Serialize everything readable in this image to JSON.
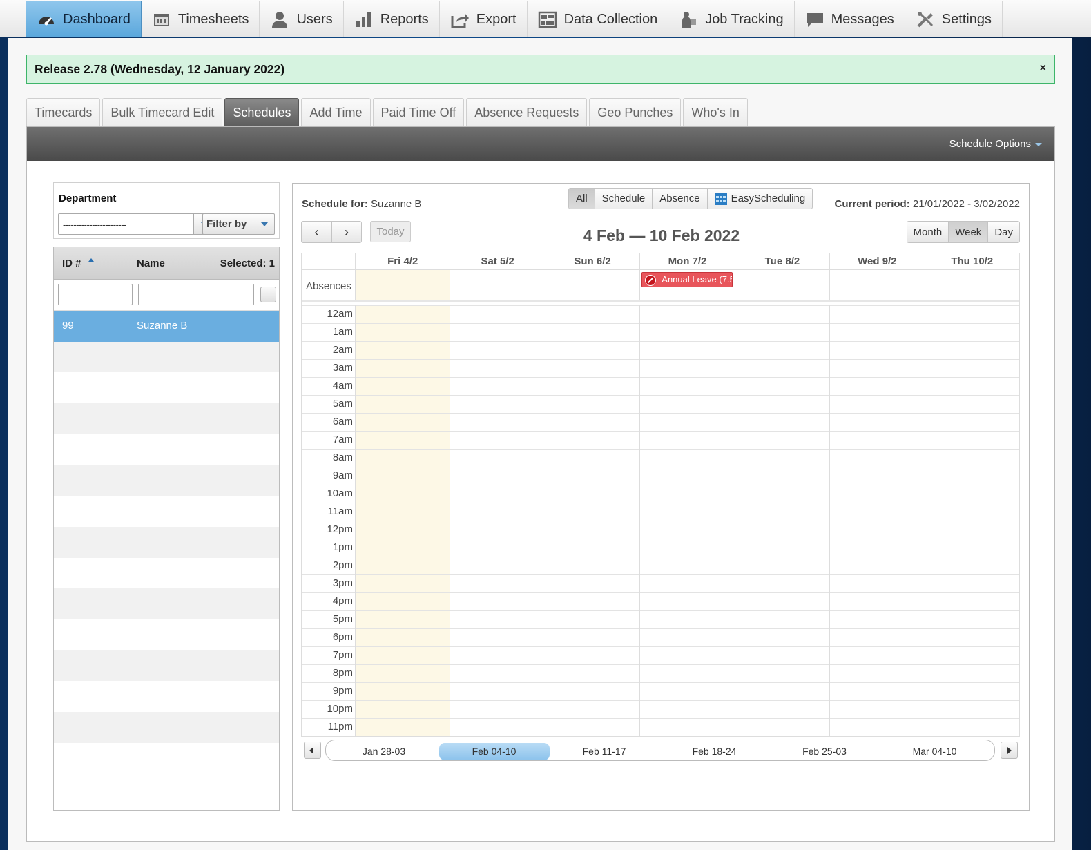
{
  "nav": {
    "items": [
      {
        "label": "Dashboard",
        "icon": "dashboard-gauge-icon",
        "active": true
      },
      {
        "label": "Timesheets",
        "icon": "calendar-icon"
      },
      {
        "label": "Users",
        "icon": "user-icon"
      },
      {
        "label": "Reports",
        "icon": "bar-chart-icon"
      },
      {
        "label": "Export",
        "icon": "export-arrow-icon"
      },
      {
        "label": "Data Collection",
        "icon": "data-collection-icon"
      },
      {
        "label": "Job Tracking",
        "icon": "job-tracking-icon"
      },
      {
        "label": "Messages",
        "icon": "speech-bubble-icon"
      },
      {
        "label": "Settings",
        "icon": "wrench-screwdriver-icon"
      }
    ]
  },
  "release": {
    "text": "Release 2.78 (Wednesday, 12 January 2022)",
    "close": "×"
  },
  "subtabs": [
    "Timecards",
    "Bulk Timecard Edit",
    "Schedules",
    "Add Time",
    "Paid Time Off",
    "Absence Requests",
    "Geo Punches",
    "Who's In"
  ],
  "active_subtab": "Schedules",
  "options_bar": {
    "label": "Schedule Options"
  },
  "department": {
    "label": "Department",
    "selected": "------------------------",
    "filter_label": "Filter by"
  },
  "employees": {
    "col_id": "ID #",
    "col_name": "Name",
    "selected_label": "Selected: 1",
    "rows": [
      {
        "id": "99",
        "name": "Suzanne B",
        "selected": true
      }
    ]
  },
  "schedule": {
    "for_label": "Schedule for:",
    "for_value": "Suzanne B",
    "filters": [
      "All",
      "Schedule",
      "Absence",
      "EasyScheduling"
    ],
    "active_filter": "All",
    "period_label": "Current period:",
    "period_value": "21/01/2022 - 3/02/2022",
    "prev": "‹",
    "next": "›",
    "today": "Today",
    "title": "4 Feb — 10 Feb 2022",
    "views": [
      "Month",
      "Week",
      "Day"
    ],
    "active_view": "Week",
    "days": [
      "Fri 4/2",
      "Sat 5/2",
      "Sun 6/2",
      "Mon 7/2",
      "Tue 8/2",
      "Wed 9/2",
      "Thu 10/2"
    ],
    "absences_label": "Absences",
    "absence_event": {
      "label": "Annual Leave (7.5",
      "day_index": 3,
      "color": "#e8555b"
    },
    "hours": [
      "12am",
      "1am",
      "2am",
      "3am",
      "4am",
      "5am",
      "6am",
      "7am",
      "8am",
      "9am",
      "10am",
      "11am",
      "12pm",
      "1pm",
      "2pm",
      "3pm",
      "4pm",
      "5pm",
      "6pm",
      "7pm",
      "8pm",
      "9pm",
      "10pm",
      "11pm"
    ],
    "periods": [
      "Jan 28-03",
      "Feb 04-10",
      "Feb 11-17",
      "Feb 18-24",
      "Feb 25-03",
      "Mar 04-10"
    ],
    "active_period": "Feb 04-10"
  },
  "colors": {
    "accent": "#6aaee0",
    "release_bg": "#d6f3e0",
    "today_bg": "#fdf8e6"
  }
}
